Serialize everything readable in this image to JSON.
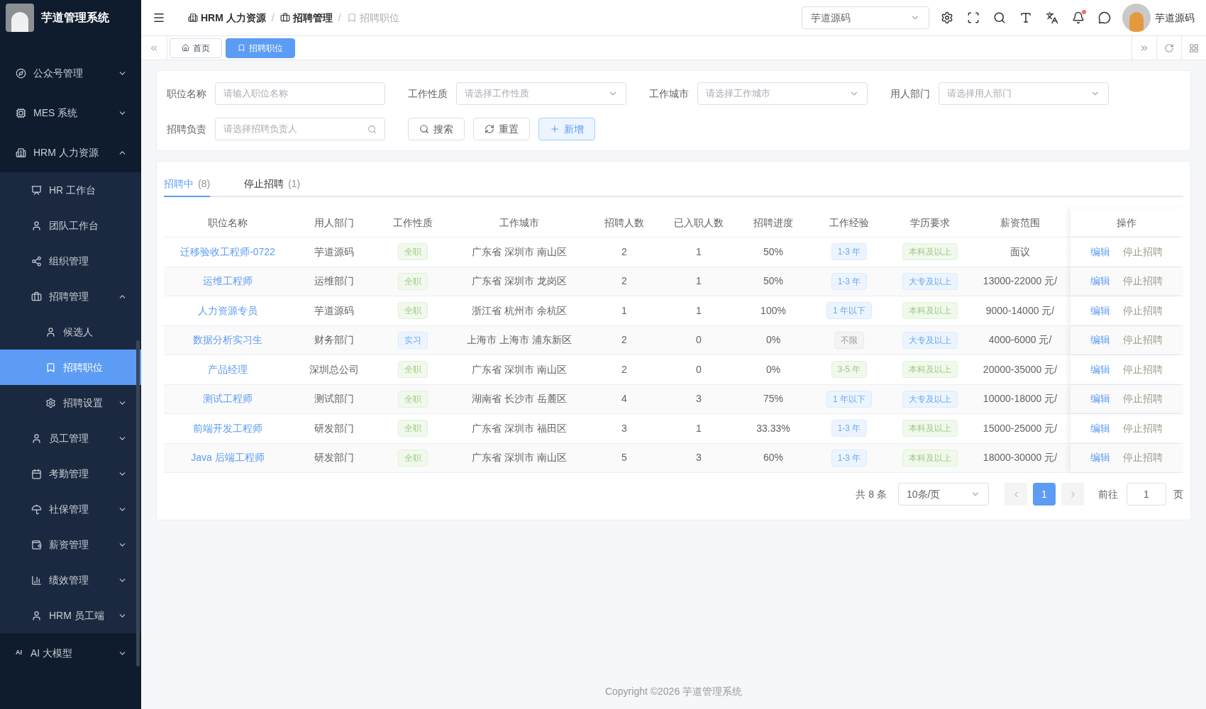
{
  "app": {
    "title": "芋道管理系统"
  },
  "sidebar": {
    "items": [
      {
        "label": "公众号管理",
        "selected": false,
        "expanded": false
      },
      {
        "label": "MES 系统",
        "selected": false,
        "expanded": false
      },
      {
        "label": "HRM 人力资源",
        "selected": false,
        "expanded": true,
        "children": [
          {
            "label": "HR 工作台",
            "selected": false
          },
          {
            "label": "团队工作台",
            "selected": false
          },
          {
            "label": "组织管理",
            "selected": false
          },
          {
            "label": "招聘管理",
            "selected": false,
            "expanded": true,
            "children": [
              {
                "label": "候选人",
                "selected": false
              },
              {
                "label": "招聘职位",
                "selected": true
              },
              {
                "label": "招聘设置",
                "selected": false,
                "expanded": false
              }
            ]
          },
          {
            "label": "员工管理",
            "selected": false,
            "expanded": false
          },
          {
            "label": "考勤管理",
            "selected": false,
            "expanded": false
          },
          {
            "label": "社保管理",
            "selected": false,
            "expanded": false
          },
          {
            "label": "薪资管理",
            "selected": false,
            "expanded": false
          },
          {
            "label": "绩效管理",
            "selected": false,
            "expanded": false
          },
          {
            "label": "HRM 员工端",
            "selected": false,
            "expanded": false
          }
        ]
      },
      {
        "label": "AI 大模型",
        "icon_label": "AI",
        "selected": false,
        "expanded": false
      }
    ]
  },
  "header": {
    "separator": "/",
    "breadcrumb": [
      {
        "label": "HRM 人力资源",
        "current": false
      },
      {
        "label": "招聘管理",
        "current": false
      },
      {
        "label": "招聘职位",
        "current": true
      }
    ],
    "tenant_select": "芋道源码",
    "user_name": "芋道源码",
    "notification_dot": true
  },
  "tags": [
    {
      "label": "首页",
      "selected": false
    },
    {
      "label": "招聘职位",
      "selected": true
    }
  ],
  "filters": [
    {
      "label": "职位名称",
      "placeholder": "请输入职位名称",
      "kind": "input"
    },
    {
      "label": "工作性质",
      "placeholder": "请选择工作性质",
      "kind": "select"
    },
    {
      "label": "工作城市",
      "placeholder": "请选择工作城市",
      "kind": "select"
    },
    {
      "label": "用人部门",
      "placeholder": "请选择用人部门",
      "kind": "select"
    },
    {
      "label": "招聘负责",
      "placeholder": "请选择招聘负责人",
      "kind": "search"
    }
  ],
  "filter_buttons": [
    {
      "label": "搜索",
      "kind": "search"
    },
    {
      "label": "重置",
      "kind": "reset"
    },
    {
      "label": "新增",
      "kind": "add"
    }
  ],
  "status_tabs": [
    {
      "label": "招聘中",
      "count": "(8)",
      "selected": true
    },
    {
      "label": "停止招聘",
      "count": "(1)",
      "selected": false
    }
  ],
  "table": {
    "columns": [
      "职位名称",
      "用人部门",
      "工作性质",
      "工作城市",
      "招聘人数",
      "已入职人数",
      "招聘进度",
      "工作经验",
      "学历要求",
      "薪资范围",
      "操作"
    ],
    "rows": [
      {
        "name": "迁移验收工程师-0722",
        "dept": "芋道源码",
        "type": {
          "text": "全职",
          "kind": "success"
        },
        "city": "广东省 深圳市 南山区",
        "openings": "2",
        "hired": "1",
        "progress": "50%",
        "experience": {
          "text": "1-3 年",
          "kind": "primary"
        },
        "education": {
          "text": "本科及以上",
          "kind": "success"
        },
        "salary": "面议",
        "actions": [
          "编辑",
          "停止招聘"
        ]
      },
      {
        "name": "运维工程师",
        "dept": "运维部门",
        "type": {
          "text": "全职",
          "kind": "success"
        },
        "city": "广东省 深圳市 龙岗区",
        "openings": "2",
        "hired": "1",
        "progress": "50%",
        "experience": {
          "text": "1-3 年",
          "kind": "primary"
        },
        "education": {
          "text": "大专及以上",
          "kind": "primary"
        },
        "salary": "13000-22000 元/",
        "actions": [
          "编辑",
          "停止招聘"
        ]
      },
      {
        "name": "人力资源专员",
        "dept": "芋道源码",
        "type": {
          "text": "全职",
          "kind": "success"
        },
        "city": "浙江省 杭州市 余杭区",
        "openings": "1",
        "hired": "1",
        "progress": "100%",
        "experience": {
          "text": "1 年以下",
          "kind": "primary"
        },
        "education": {
          "text": "本科及以上",
          "kind": "success"
        },
        "salary": "9000-14000 元/",
        "actions": [
          "编辑",
          "停止招聘"
        ]
      },
      {
        "name": "数据分析实习生",
        "dept": "财务部门",
        "type": {
          "text": "实习",
          "kind": "primary"
        },
        "city": "上海市 上海市 浦东新区",
        "openings": "2",
        "hired": "0",
        "progress": "0%",
        "experience": {
          "text": "不限",
          "kind": "info"
        },
        "education": {
          "text": "大专及以上",
          "kind": "primary"
        },
        "salary": "4000-6000 元/",
        "actions": [
          "编辑",
          "停止招聘"
        ]
      },
      {
        "name": "产品经理",
        "dept": "深圳总公司",
        "type": {
          "text": "全职",
          "kind": "success"
        },
        "city": "广东省 深圳市 南山区",
        "openings": "2",
        "hired": "0",
        "progress": "0%",
        "experience": {
          "text": "3-5 年",
          "kind": "success"
        },
        "education": {
          "text": "本科及以上",
          "kind": "success"
        },
        "salary": "20000-35000 元/",
        "actions": [
          "编辑",
          "停止招聘"
        ]
      },
      {
        "name": "测试工程师",
        "dept": "测试部门",
        "type": {
          "text": "全职",
          "kind": "success"
        },
        "city": "湖南省 长沙市 岳麓区",
        "openings": "4",
        "hired": "3",
        "progress": "75%",
        "experience": {
          "text": "1 年以下",
          "kind": "primary"
        },
        "education": {
          "text": "大专及以上",
          "kind": "primary"
        },
        "salary": "10000-18000 元/",
        "actions": [
          "编辑",
          "停止招聘"
        ]
      },
      {
        "name": "前端开发工程师",
        "dept": "研发部门",
        "type": {
          "text": "全职",
          "kind": "success"
        },
        "city": "广东省 深圳市 福田区",
        "openings": "3",
        "hired": "1",
        "progress": "33.33%",
        "experience": {
          "text": "1-3 年",
          "kind": "primary"
        },
        "education": {
          "text": "本科及以上",
          "kind": "success"
        },
        "salary": "15000-25000 元/",
        "actions": [
          "编辑",
          "停止招聘"
        ]
      },
      {
        "name": "Java 后端工程师",
        "dept": "研发部门",
        "type": {
          "text": "全职",
          "kind": "success"
        },
        "city": "广东省 深圳市 南山区",
        "openings": "5",
        "hired": "3",
        "progress": "60%",
        "experience": {
          "text": "1-3 年",
          "kind": "primary"
        },
        "education": {
          "text": "本科及以上",
          "kind": "success"
        },
        "salary": "18000-30000 元/",
        "actions": [
          "编辑",
          "停止招聘"
        ]
      }
    ]
  },
  "pagination": {
    "total": "共 8 条",
    "page_size": "10条/页",
    "pages": [
      {
        "label": "1",
        "selected": true
      }
    ],
    "goto_label": "前往",
    "goto_value": "1",
    "goto_suffix": "页"
  },
  "footer": "Copyright ©2026 芋道管理系统"
}
